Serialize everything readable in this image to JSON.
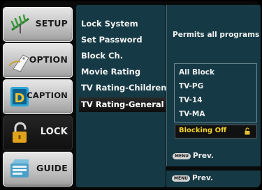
{
  "nav": {
    "items": [
      {
        "label": "SETUP",
        "icon": "antenna-icon",
        "active": false
      },
      {
        "label": "OPTION",
        "icon": "tag-icon",
        "active": false
      },
      {
        "label": "CAPTION",
        "icon": "caption-d-icon",
        "active": false
      },
      {
        "label": "LOCK",
        "icon": "padlock-icon",
        "active": true
      },
      {
        "label": "GUIDE",
        "icon": "guide-icon",
        "active": false
      }
    ]
  },
  "submenu": {
    "items": [
      {
        "label": "Lock System"
      },
      {
        "label": "Set Password"
      },
      {
        "label": "Block Ch."
      },
      {
        "label": "Movie Rating"
      },
      {
        "label": "TV Rating-Children"
      },
      {
        "label": "TV Rating-General",
        "selected": true
      }
    ]
  },
  "panel": {
    "title": "Permits all programs",
    "options": [
      "All Block",
      "TV-PG",
      "TV-14",
      "TV-MA"
    ],
    "blocking": "Blocking Off",
    "prev_label": "Prev.",
    "menu_key": "MENU"
  },
  "footer": {
    "prev_label": "Prev.",
    "menu_key": "MENU"
  },
  "colors": {
    "panel_bg": "#163a45",
    "highlight_text": "#f4d22a"
  }
}
